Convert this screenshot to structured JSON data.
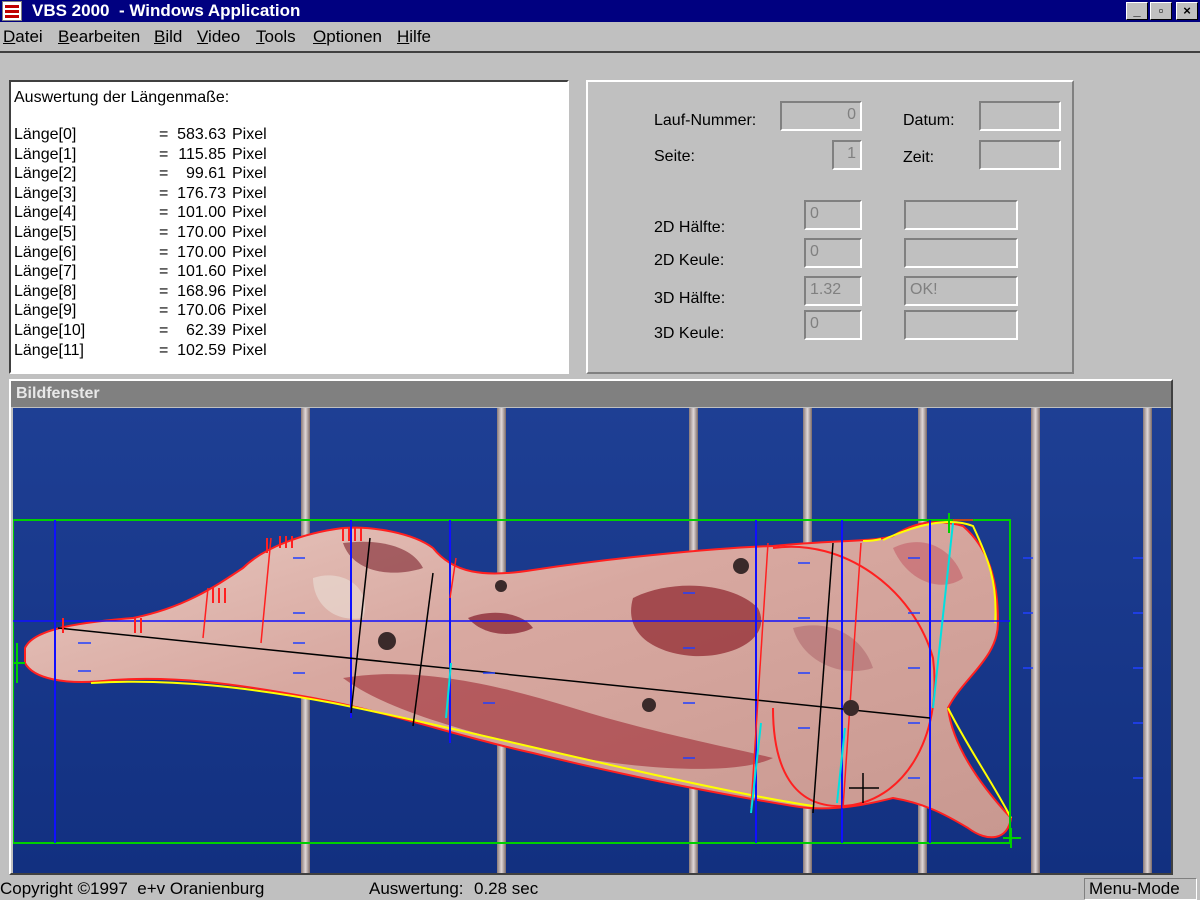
{
  "window": {
    "title": "VBS 2000  - Windows Application",
    "minimize_glyph": "_",
    "maximize_glyph": "▫",
    "close_glyph": "×"
  },
  "menu": [
    {
      "label": "Datei"
    },
    {
      "label": "Bearbeiten"
    },
    {
      "label": "Bild"
    },
    {
      "label": "Video"
    },
    {
      "label": "Tools"
    },
    {
      "label": "Optionen"
    },
    {
      "label": "Hilfe"
    }
  ],
  "results": {
    "title": "Auswertung der Längenmaße:",
    "equals": "=",
    "unit": "Pixel",
    "rows": [
      {
        "label": "Länge[0]",
        "value": "583.63"
      },
      {
        "label": "Länge[1]",
        "value": "115.85"
      },
      {
        "label": "Länge[2]",
        "value": "99.61"
      },
      {
        "label": "Länge[3]",
        "value": "176.73"
      },
      {
        "label": "Länge[4]",
        "value": "101.00"
      },
      {
        "label": "Länge[5]",
        "value": "170.00"
      },
      {
        "label": "Länge[6]",
        "value": "170.00"
      },
      {
        "label": "Länge[7]",
        "value": "101.60"
      },
      {
        "label": "Länge[8]",
        "value": "168.96"
      },
      {
        "label": "Länge[9]",
        "value": "170.06"
      },
      {
        "label": "Länge[10]",
        "value": "62.39"
      },
      {
        "label": "Länge[11]",
        "value": "102.59"
      }
    ]
  },
  "info": {
    "lauf_nummer_label": "Lauf-Nummer:",
    "lauf_nummer_value": "0",
    "datum_label": "Datum:",
    "datum_value": "",
    "seite_label": "Seite:",
    "seite_value": "1",
    "zeit_label": "Zeit:",
    "zeit_value": "",
    "haelfte_2d_label": "2D Hälfte:",
    "haelfte_2d_value": "0",
    "haelfte_2d_status": "",
    "keule_2d_label": "2D Keule:",
    "keule_2d_value": "0",
    "keule_2d_status": "",
    "haelfte_3d_label": "3D Hälfte:",
    "haelfte_3d_value": "1.32",
    "haelfte_3d_status": "OK!",
    "keule_3d_label": "3D Keule:",
    "keule_3d_value": "0",
    "keule_3d_status": ""
  },
  "image_window": {
    "title": "Bildfenster"
  },
  "status": {
    "copyright": "Copyright ©1997  e+v Oranienburg",
    "eval_label": "Auswertung:",
    "eval_value": "0.28 sec",
    "mode": "Menu-Mode"
  },
  "colors": {
    "title_bar": "#000080",
    "background": "#c0c0c0",
    "image_background": "#1a3a8a",
    "outline_red": "#ff2020",
    "outline_yellow": "#ffff00",
    "bounding_box_green": "#00d000",
    "measure_blue": "#1010ff",
    "measure_cyan": "#00e0e0"
  }
}
